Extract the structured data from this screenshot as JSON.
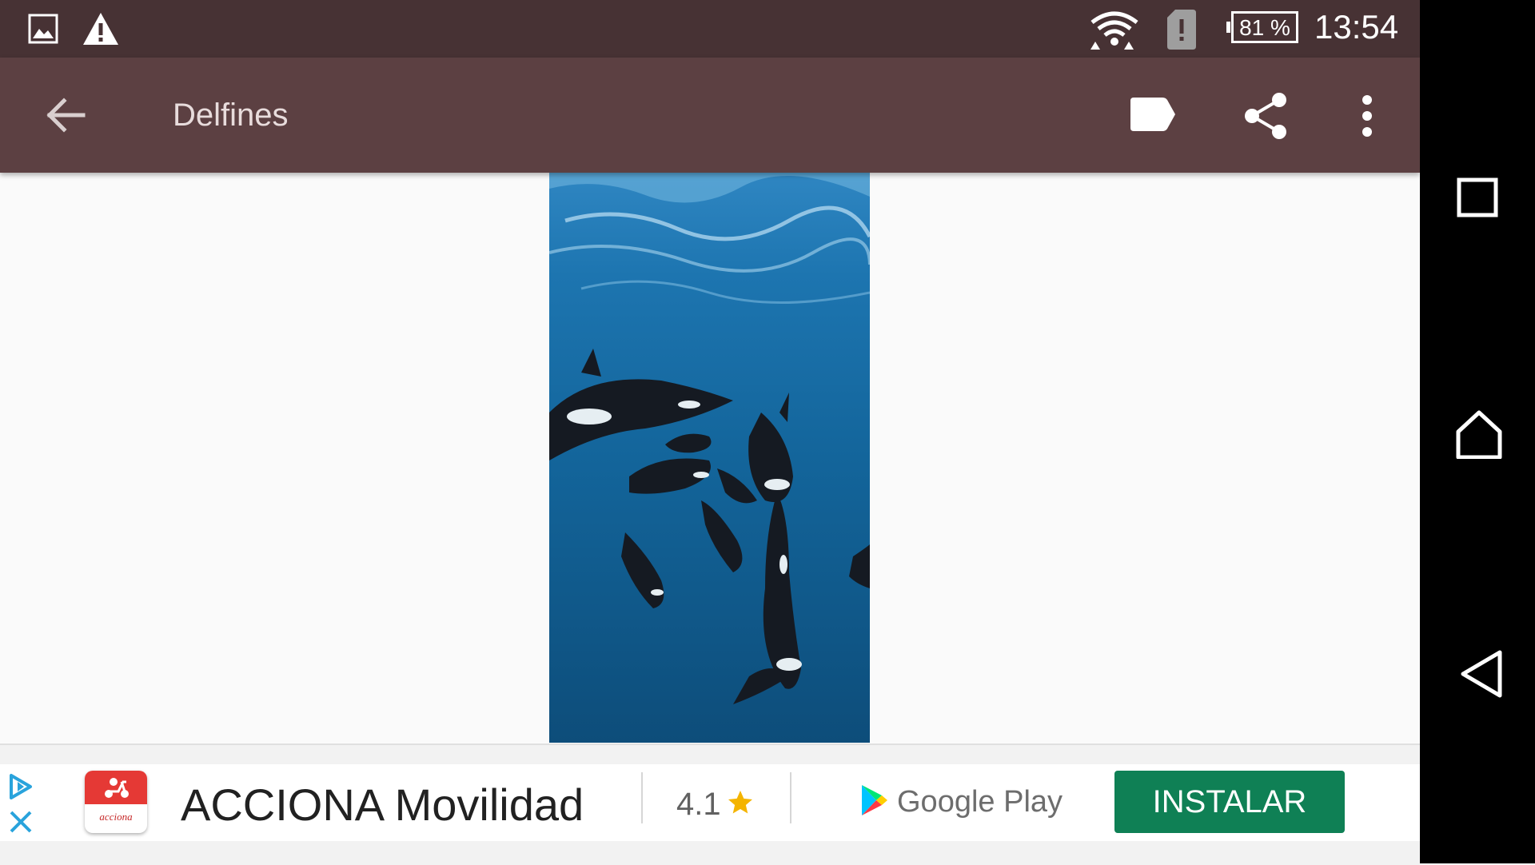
{
  "status_bar": {
    "battery_percent": "81 %",
    "time": "13:54",
    "icons": [
      "image-icon",
      "warning-icon",
      "wifi-icon",
      "sim-alert-icon",
      "battery-icon"
    ]
  },
  "app_bar": {
    "title": "Delfines",
    "icons": [
      "back-arrow-icon",
      "label-icon",
      "share-icon",
      "more-vert-icon"
    ]
  },
  "content": {
    "image_icon": "orca-photo"
  },
  "ad": {
    "app_name": "ACCIONA Movilidad",
    "rating": "4.1",
    "store": "Google Play",
    "install_label": "INSTALAR",
    "app_icon_label": "acciona",
    "colors": {
      "install_button": "#0f8055",
      "star": "#f4b400",
      "app_icon_bg": "#e53935"
    }
  },
  "nav_bar": {
    "icons": [
      "recents-icon",
      "home-icon",
      "back-icon"
    ]
  },
  "colors": {
    "status_bar": "#473234",
    "app_bar": "#5c4042",
    "nav_bar": "#000000"
  }
}
